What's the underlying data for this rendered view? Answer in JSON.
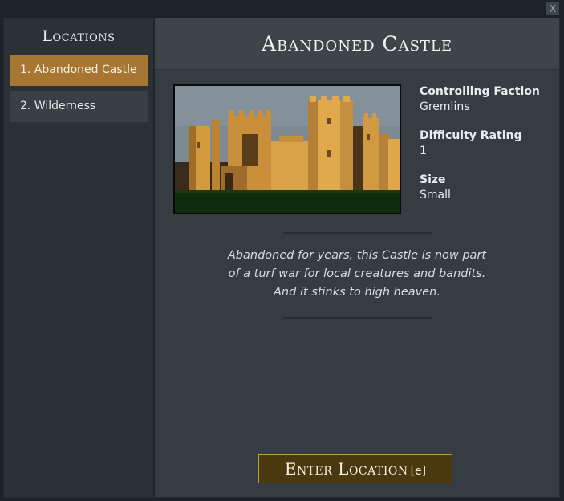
{
  "close": {
    "label": "X"
  },
  "sidebar": {
    "title": "Locations",
    "items": [
      {
        "label": "1. Abandoned Castle",
        "active": true
      },
      {
        "label": "2. Wilderness",
        "active": false
      }
    ]
  },
  "location": {
    "title": "Abandoned Castle",
    "details": [
      {
        "label": "Controlling Faction",
        "value": "Gremlins"
      },
      {
        "label": "Difficulty Rating",
        "value": "1"
      },
      {
        "label": "Size",
        "value": "Small"
      }
    ],
    "description": "Abandoned for years, this Castle is now part of a turf war for local creatures and bandits. And it stinks to high heaven."
  },
  "enter_button": {
    "label": "Enter Location",
    "key": "[e]"
  },
  "colors": {
    "accent": "#a87633",
    "button_bg": "#4a380f",
    "button_border": "#c19a3a",
    "panel_bg": "#363d42"
  }
}
